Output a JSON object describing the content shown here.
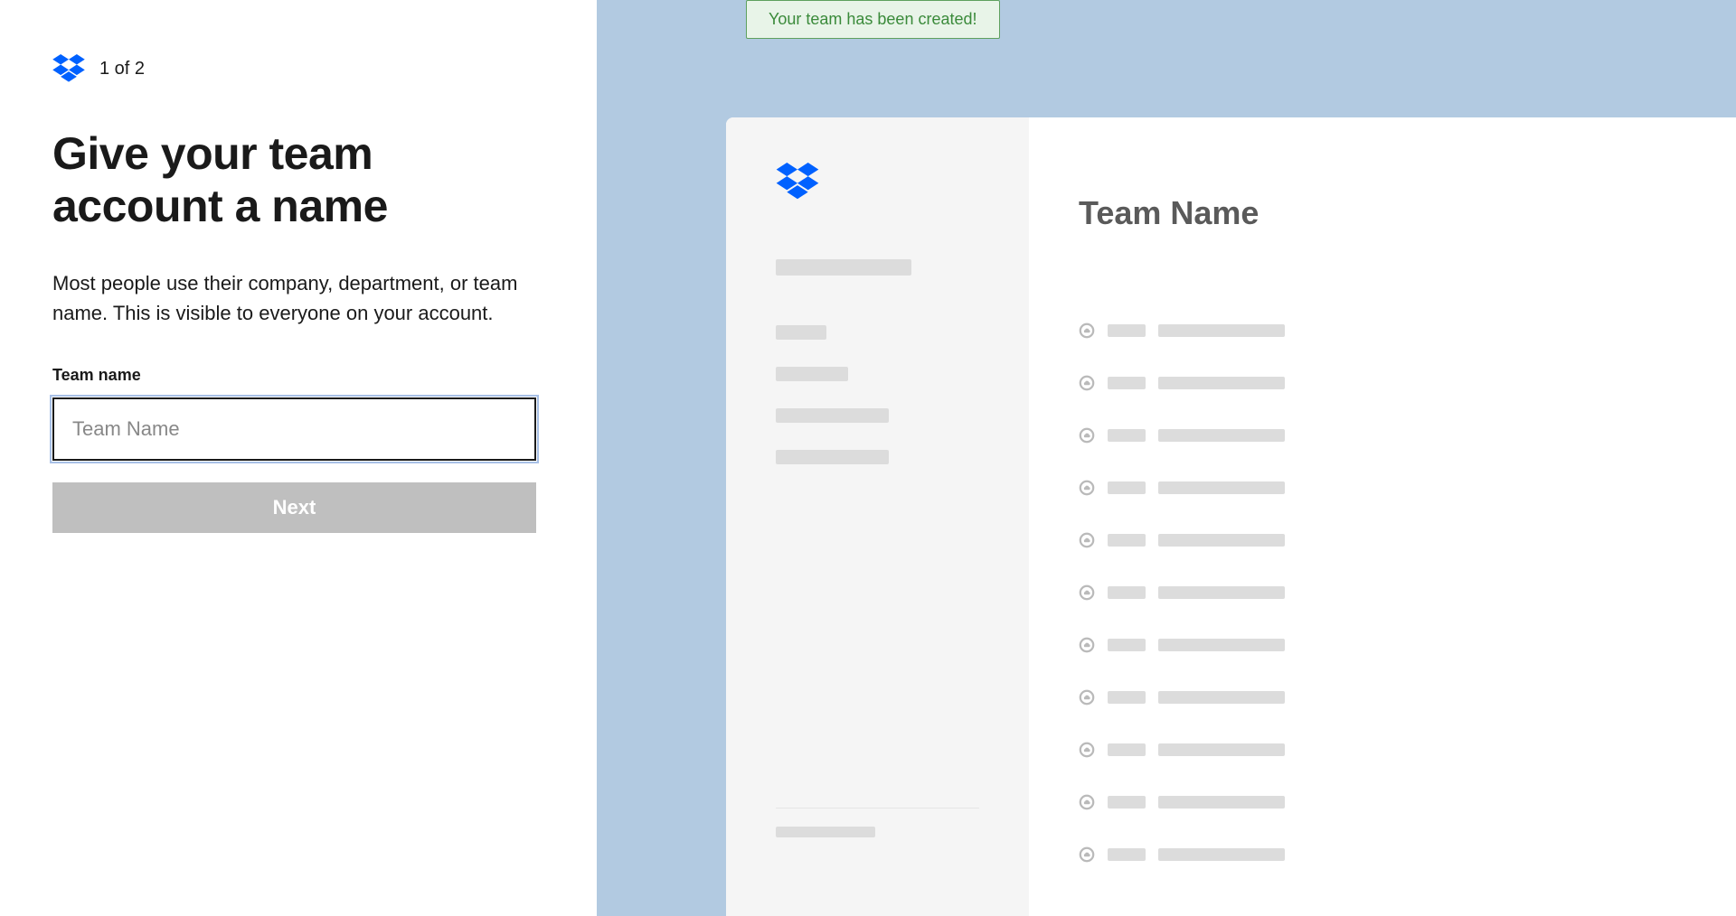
{
  "step": {
    "counter": "1 of 2"
  },
  "heading": "Give your team account a name",
  "description": "Most people use their company, department, or team name. This is visible to everyone on your account.",
  "field": {
    "label": "Team name",
    "placeholder": "Team Name"
  },
  "button": {
    "next": "Next"
  },
  "toast": {
    "message": "Your team has been created!"
  },
  "preview": {
    "title": "Team Name",
    "rows_count": 11
  }
}
